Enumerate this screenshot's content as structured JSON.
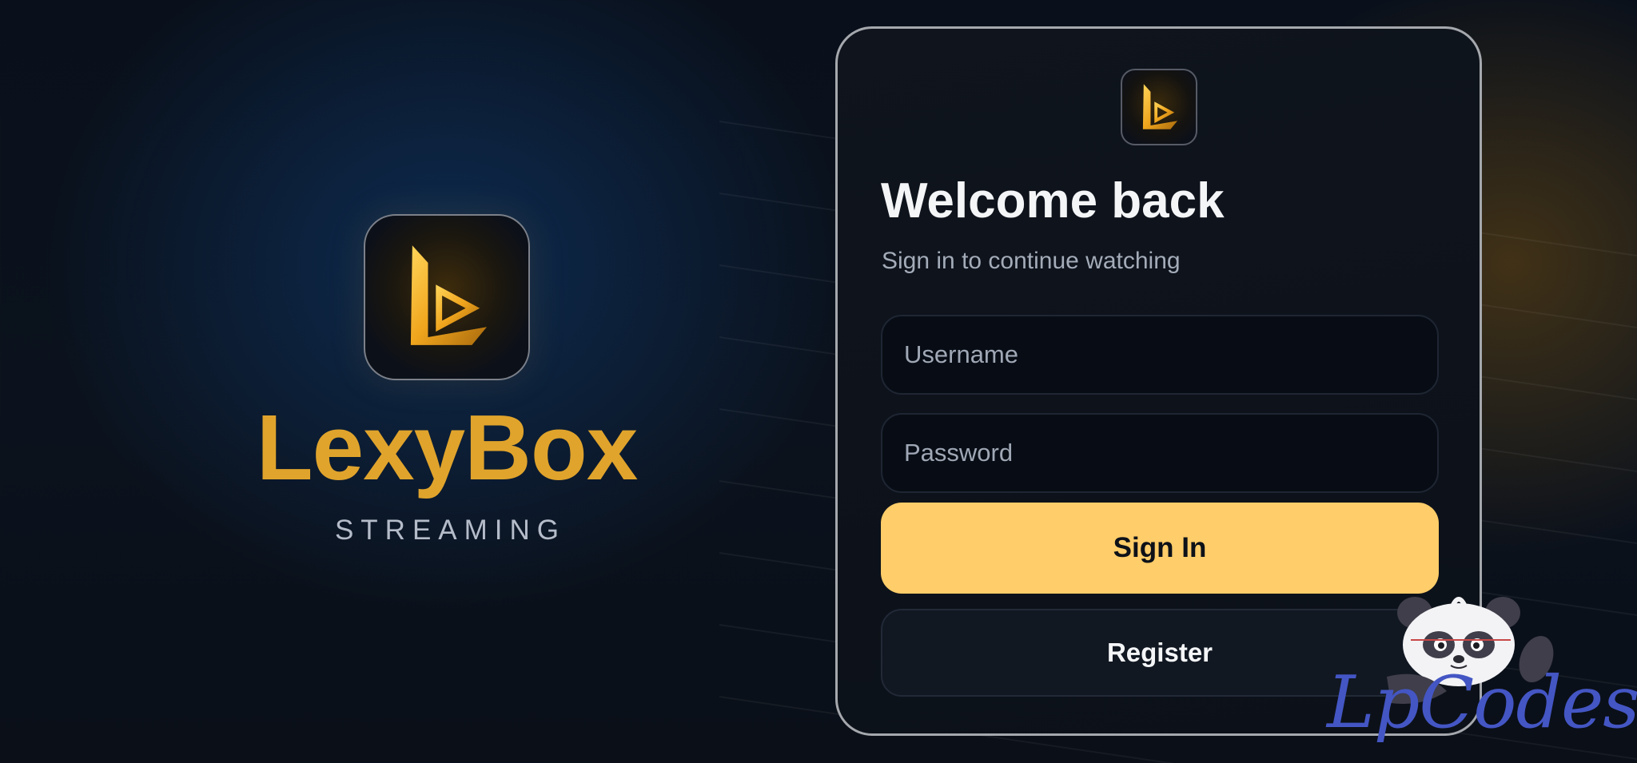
{
  "brand": {
    "name": "LexyBox",
    "tagline": "STREAMING",
    "logo_icon": "lexybox-play-logo-icon"
  },
  "login": {
    "logo_icon": "lexybox-play-logo-icon",
    "title": "Welcome back",
    "subtitle": "Sign in to continue watching",
    "username": {
      "placeholder": "Username",
      "value": ""
    },
    "password": {
      "placeholder": "Password",
      "value": ""
    },
    "sign_in_label": "Sign In",
    "register_label": "Register"
  },
  "watermark": {
    "text": "LpCodes",
    "mascot_icon": "panda-mascot-icon"
  },
  "colors": {
    "accent": "#ffcd69",
    "brand_gold": "#e0a42c",
    "card_bg": "#0f141d",
    "card_border": "#a5a8ad",
    "watermark_blue": "#4456c4"
  }
}
